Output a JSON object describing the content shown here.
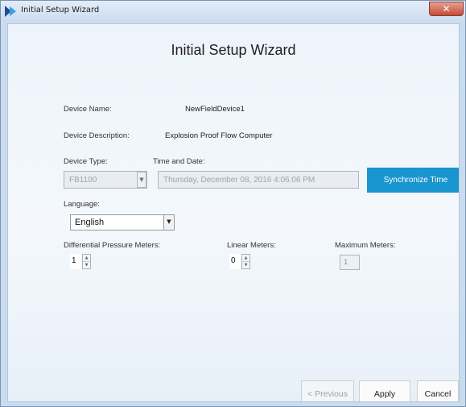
{
  "window": {
    "title": "Initial Setup Wizard",
    "close_glyph": "✕"
  },
  "wizard": {
    "heading": "Initial Setup Wizard",
    "device_name": {
      "label": "Device Name:",
      "value": "NewFieldDevice1"
    },
    "device_description": {
      "label": "Device Description:",
      "value": "Explosion Proof Flow Computer"
    },
    "device_type": {
      "label": "Device Type:",
      "value": "FB1100"
    },
    "time_and_date": {
      "label": "Time and Date:",
      "value": "Thursday, December 08, 2016 4:06:06 PM"
    },
    "sync_button": "Synchronize Time",
    "language": {
      "label": "Language:",
      "value": "English"
    },
    "differential_pressure_meters": {
      "label": "Differential Pressure Meters:",
      "value": "1"
    },
    "linear_meters": {
      "label": "Linear Meters:",
      "value": "0"
    },
    "maximum_meters": {
      "label": "Maximum Meters:",
      "value": "1"
    }
  },
  "buttons": {
    "previous": "< Previous",
    "apply": "Apply",
    "cancel": "Cancel"
  },
  "icons": {
    "app": "wizard-app-icon",
    "dropdown": "▼",
    "spin_up": "▲",
    "spin_down": "▼"
  },
  "colors": {
    "accent": "#1995cf",
    "close": "#c44a36"
  }
}
